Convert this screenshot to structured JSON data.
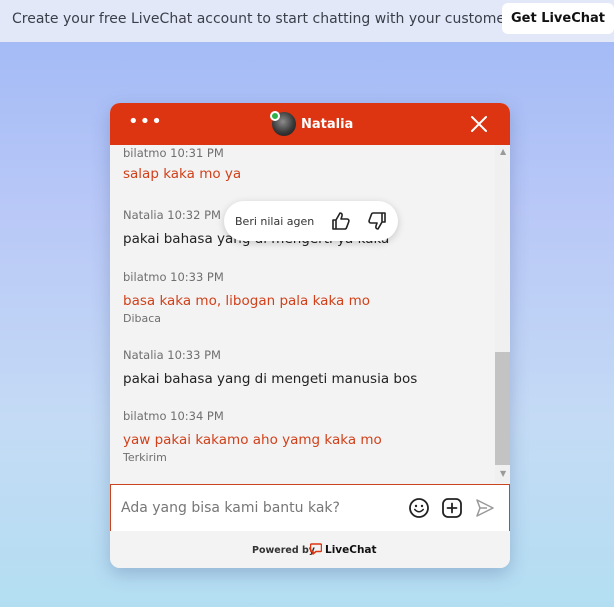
{
  "banner": {
    "text": "Create your free LiveChat account to start chatting with your customers.",
    "button_label": "Get LiveChat"
  },
  "header": {
    "menu_label": "•••",
    "agent_name": "Natalia"
  },
  "rating": {
    "label": "Beri nilai agen"
  },
  "messages": [
    {
      "author": "bilatmo 10:31 PM",
      "text": "salap kaka mo ya",
      "type": "visitor",
      "status": ""
    },
    {
      "author": "Natalia 10:32 PM",
      "text": "pakai bahasa yang di mengerti ya kaka",
      "type": "agent",
      "status": ""
    },
    {
      "author": "bilatmo 10:33 PM",
      "text": "basa kaka mo, libogan pala kaka mo",
      "type": "visitor",
      "status": "Dibaca"
    },
    {
      "author": "Natalia 10:33 PM",
      "text": "pakai bahasa yang di mengeti manusia bos",
      "type": "agent",
      "status": ""
    },
    {
      "author": "bilatmo 10:34 PM",
      "text": "yaw pakai kakamo aho yamg kaka mo",
      "type": "visitor",
      "status": "Terkirim"
    }
  ],
  "composer": {
    "placeholder": "Ada yang bisa kami bantu kak?"
  },
  "footer": {
    "powered_by": "Powered by",
    "brand": "LiveChat"
  },
  "colors": {
    "brand_red": "#dd3511",
    "visitor_text": "#d0411b"
  }
}
